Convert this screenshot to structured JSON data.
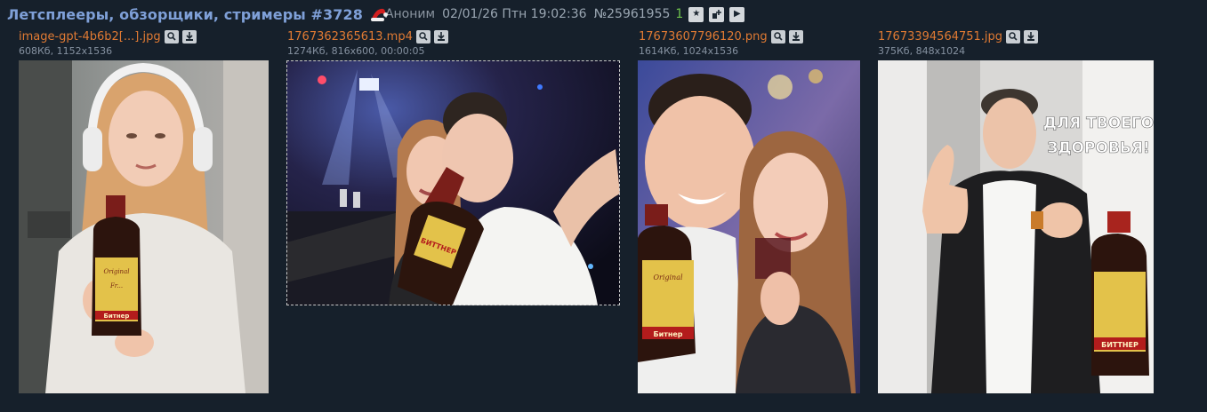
{
  "post": {
    "thread_title": "Летсплееры, обзорщики, стримеры #3728",
    "author": "Аноним",
    "date": "02/01/26 Птн 19:02:36",
    "number": "№25961955",
    "replies": "1",
    "buttons": [
      {
        "icon": "star-icon"
      },
      {
        "icon": "reply-plus-icon"
      },
      {
        "icon": "play-icon"
      }
    ]
  },
  "files": [
    {
      "name": "image-gpt-4b6b2[...].jpg",
      "meta": "608Кб, 1152x1536",
      "search_icon": "search-icon",
      "download_icon": "download-icon",
      "thumb_text": [
        "Original",
        "Fr...",
        "Битнер"
      ]
    },
    {
      "name": "1767362365613.mp4",
      "meta": "1274Кб, 816x600, 00:00:05",
      "search_icon": "search-icon",
      "download_icon": "download-icon",
      "thumb_text": [
        "БИТТНЕР"
      ]
    },
    {
      "name": "17673607796120.png",
      "meta": "1614Кб, 1024x1536",
      "search_icon": "search-icon",
      "download_icon": "download-icon",
      "thumb_text": [
        "Original",
        "Битнер"
      ]
    },
    {
      "name": "17673394564751.jpg",
      "meta": "375Кб, 848x1024",
      "search_icon": "search-icon",
      "download_icon": "download-icon",
      "thumb_text": [
        "ДЛЯ ТВОЕГО",
        "ЗДОРОВЬЯ!",
        "БИТТНЕР"
      ]
    }
  ],
  "colors": {
    "background": "#16202b",
    "title": "#7fa0d8",
    "filename": "#e07a33",
    "reply_count": "#6fc24c"
  }
}
